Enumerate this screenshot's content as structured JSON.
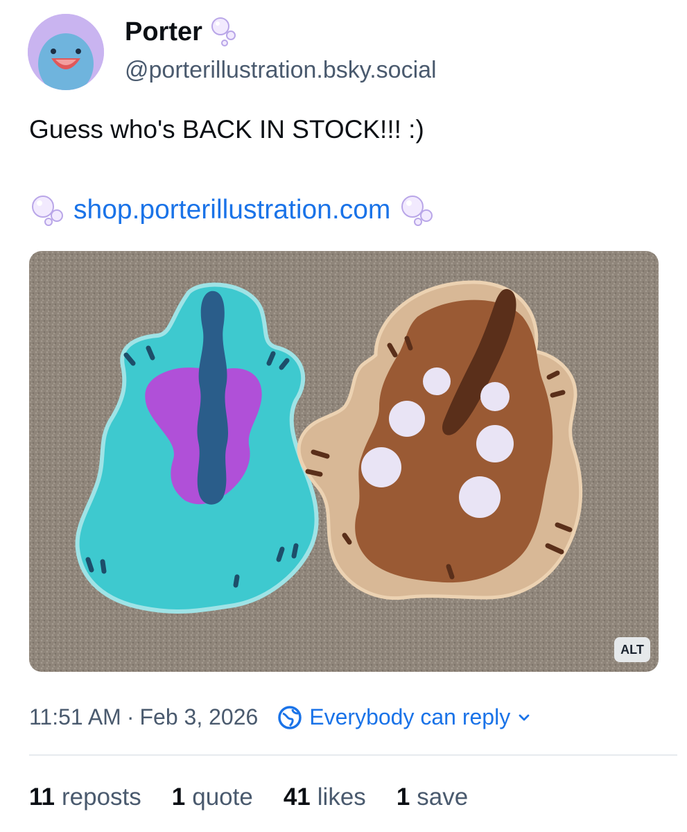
{
  "post": {
    "author": {
      "display_name": "Porter",
      "handle": "@porterillustration.bsky.social",
      "name_emoji": "bubbles-icon"
    },
    "text": "Guess who's BACK IN STOCK!!! :)",
    "link": "shop.porterillustration.com",
    "media": {
      "alt_badge": "ALT"
    },
    "time": "11:51 AM",
    "separator": "·",
    "date": "Feb 3, 2026",
    "reply_setting": "Everybody can reply",
    "stats": [
      {
        "count": "11",
        "label": "reposts"
      },
      {
        "count": "1",
        "label": "quote"
      },
      {
        "count": "41",
        "label": "likes"
      },
      {
        "count": "1",
        "label": "save"
      }
    ]
  },
  "colors": {
    "link_blue": "#1a73e8",
    "muted_text": "#4a5a6e",
    "primary_text": "#0b0f14"
  }
}
